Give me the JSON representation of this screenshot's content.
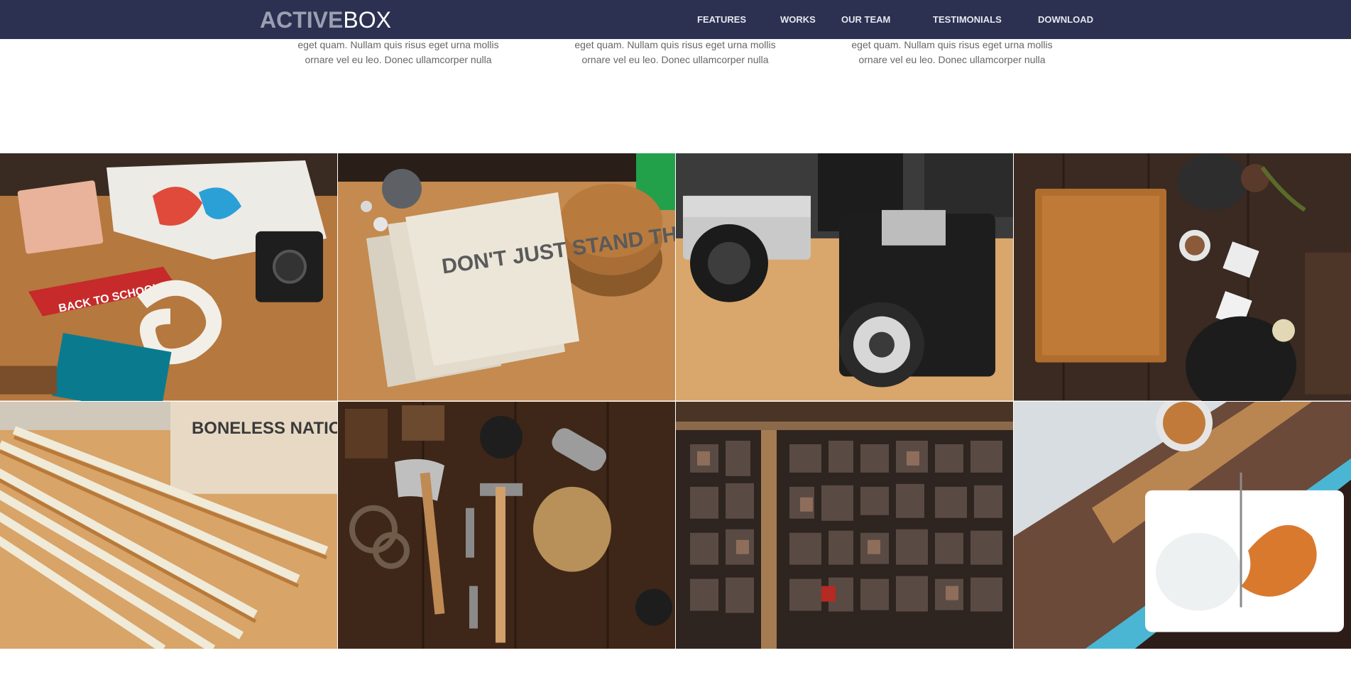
{
  "header": {
    "logo_bold": "ACTIVE",
    "logo_light": "BOX",
    "nav": [
      "FEATURES",
      "WORKS",
      "OUR TEAM",
      "TESTIMONIALS",
      "DOWNLOAD"
    ]
  },
  "intro": [
    {
      "line1": "eget quam. Nullam quis risus eget urna mollis",
      "line2": "ornare vel eu leo. Donec ullamcorper nulla"
    },
    {
      "line1": "eget quam. Nullam quis risus eget urna mollis",
      "line2": "ornare vel eu leo. Donec ullamcorper nulla"
    },
    {
      "line1": "eget quam. Nullam quis risus eget urna mollis",
      "line2": "ornare vel eu leo. Donec ullamcorper nulla"
    }
  ],
  "gallery": {
    "items": [
      {
        "icon": "flatlay-photo-icon",
        "caption_text": "BACK TO SCHOOL"
      },
      {
        "icon": "notebook-photo-icon",
        "caption_text": "DON'T JUST STAND THERE"
      },
      {
        "icon": "camera-photo-icon",
        "caption_text": ""
      },
      {
        "icon": "kitchen-photo-icon",
        "caption_text": ""
      },
      {
        "icon": "rulers-photo-icon",
        "caption_text": "BONELESS NATIONAL STORES"
      },
      {
        "icon": "tools-photo-icon",
        "caption_text": ""
      },
      {
        "icon": "letterpress-photo-icon",
        "caption_text": ""
      },
      {
        "icon": "breakfast-photo-icon",
        "caption_text": ""
      }
    ]
  },
  "colors": {
    "navbar": "#2c3151",
    "nav_text": "#e6e8ef",
    "body_text": "#666666"
  }
}
